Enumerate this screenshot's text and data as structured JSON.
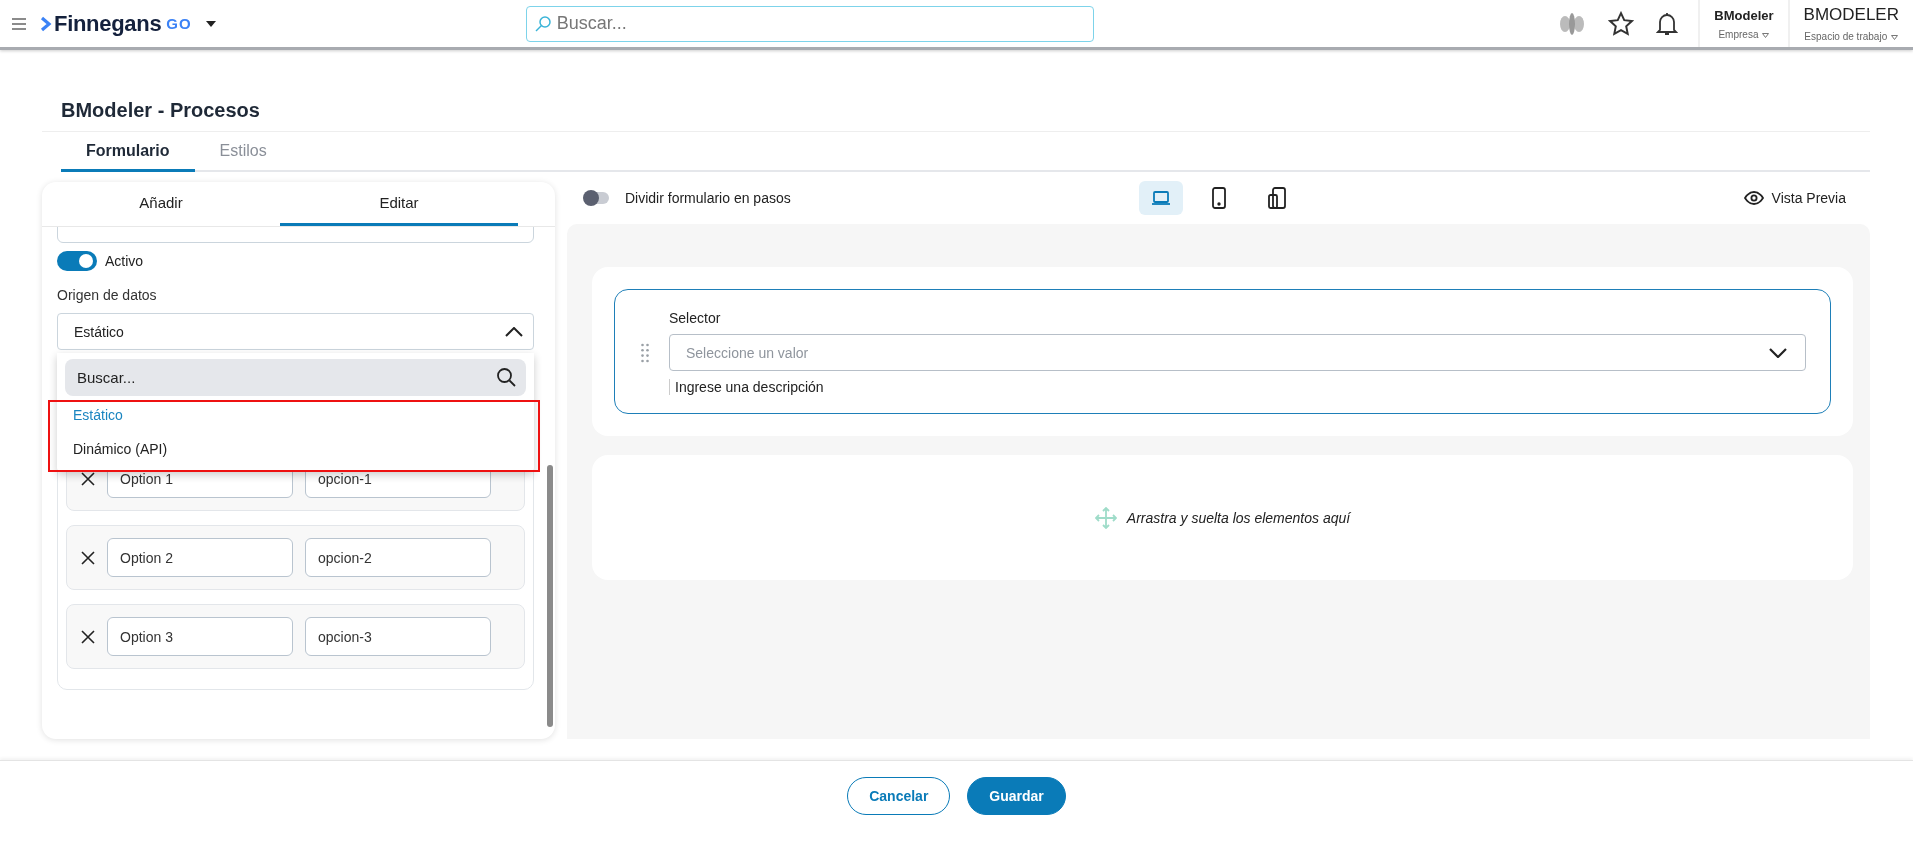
{
  "header": {
    "brand": "Finnegans",
    "brand_suffix": "GO",
    "search_placeholder": "Buscar...",
    "company": {
      "name": "BModeler",
      "label": "Empresa"
    },
    "workspace": {
      "name": "BMODELER",
      "label": "Espacio de trabajo"
    }
  },
  "page_title": "BModeler - Procesos",
  "tabs": [
    {
      "label": "Formulario",
      "selected": true
    },
    {
      "label": "Estilos",
      "selected": false
    }
  ],
  "editor_panel": {
    "tabs": [
      {
        "label": "Añadir",
        "selected": false
      },
      {
        "label": "Editar",
        "selected": true
      }
    ],
    "active_toggle": {
      "label": "Activo",
      "on": true
    },
    "data_source": {
      "label": "Origen de datos",
      "value": "Estático",
      "expanded": true,
      "search_placeholder": "Buscar...",
      "options": [
        {
          "label": "Estático",
          "selected": true
        },
        {
          "label": "Dinámico (API)",
          "selected": false
        }
      ]
    },
    "options": [
      {
        "label": "Option 1",
        "value": "opcion-1"
      },
      {
        "label": "Option 2",
        "value": "opcion-2"
      },
      {
        "label": "Option 3",
        "value": "opcion-3"
      }
    ]
  },
  "toolbar": {
    "split_toggle": {
      "label": "Dividir formulario en pasos",
      "on": false
    },
    "devices": [
      {
        "kind": "laptop",
        "selected": true
      },
      {
        "kind": "tablet",
        "selected": false
      },
      {
        "kind": "mobile",
        "selected": false
      }
    ],
    "preview": "Vista Previa"
  },
  "canvas": {
    "field": {
      "label": "Selector",
      "placeholder": "Seleccione un valor",
      "description": "Ingrese una descripción",
      "selected": true
    },
    "dropzone": "Arrastra y suelta los elementos aquí"
  },
  "footer": {
    "buttons": [
      {
        "label": "Cancelar",
        "kind": "secondary"
      },
      {
        "label": "Guardar",
        "kind": "primary"
      }
    ]
  }
}
